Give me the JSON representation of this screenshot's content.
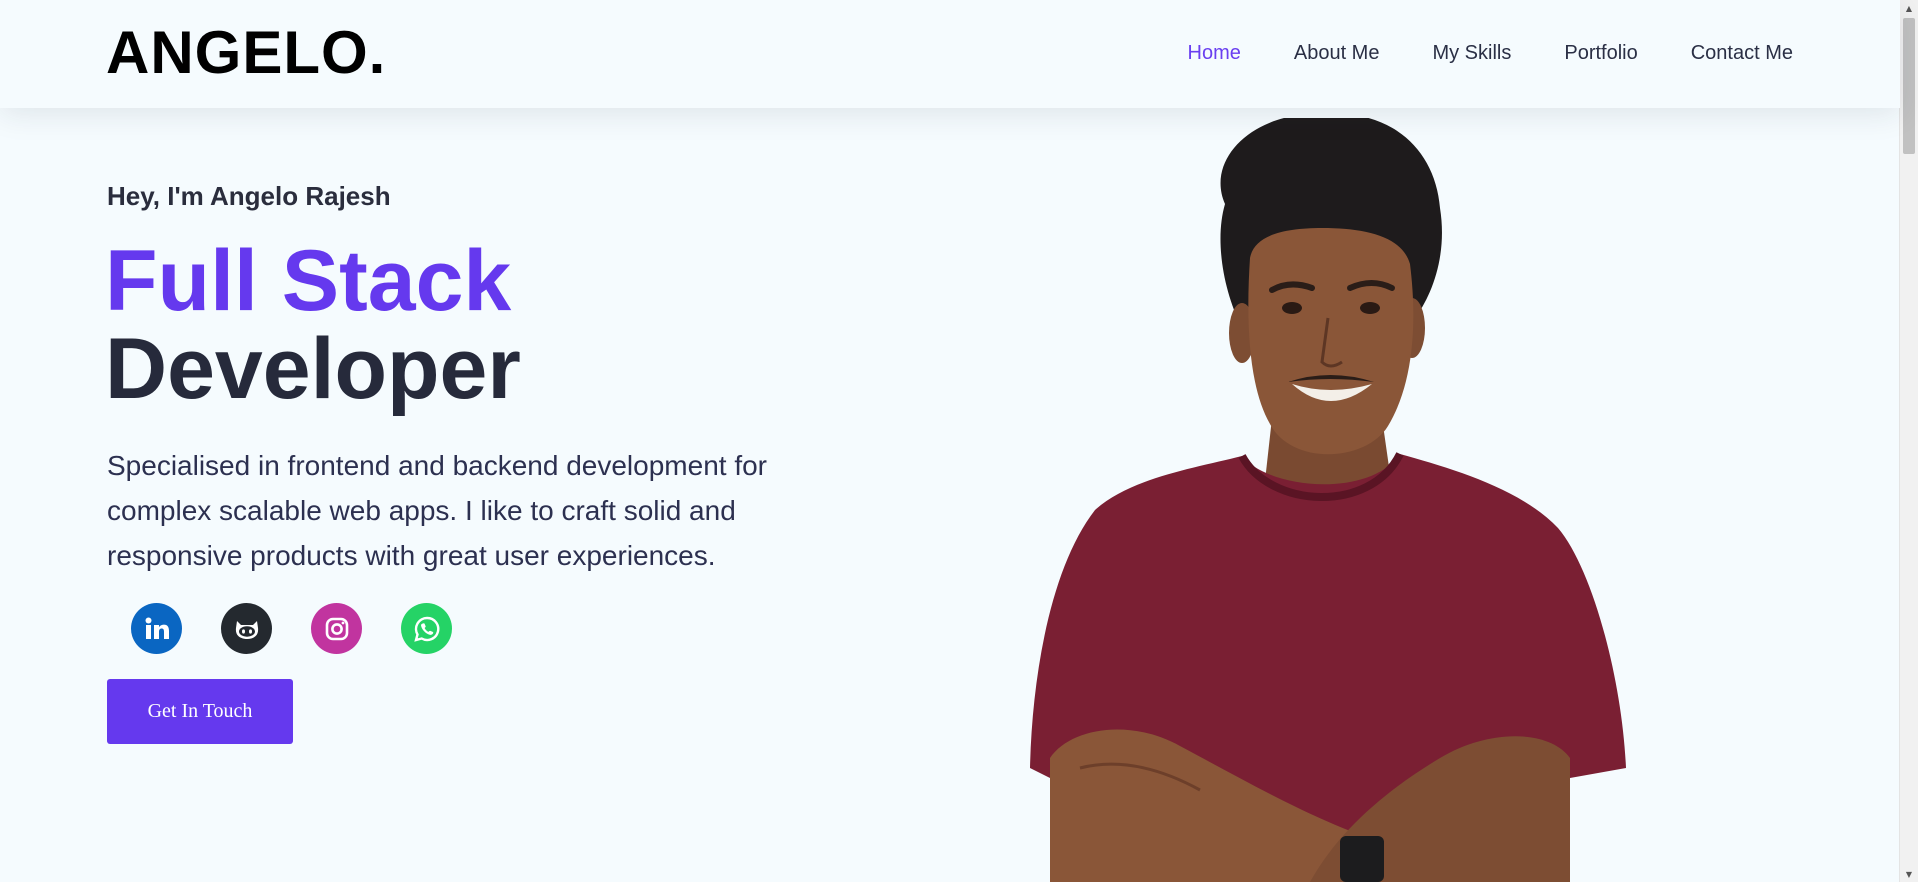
{
  "header": {
    "logo": "ANGELO.",
    "nav": [
      {
        "label": "Home",
        "active": true
      },
      {
        "label": "About Me",
        "active": false
      },
      {
        "label": "My Skills",
        "active": false
      },
      {
        "label": "Portfolio",
        "active": false
      },
      {
        "label": "Contact Me",
        "active": false
      }
    ]
  },
  "hero": {
    "greeting": "Hey, I'm Angelo Rajesh",
    "title_accent": "Full Stack",
    "title_main": "Developer",
    "description": "Specialised in frontend and backend development for complex scalable web apps. I like to craft solid and responsive products with great user experiences.",
    "socials": [
      {
        "icon": "linkedin-icon",
        "color": "#0a66c2"
      },
      {
        "icon": "github-icon",
        "color": "#24292f"
      },
      {
        "icon": "instagram-icon",
        "color": "#c1349f"
      },
      {
        "icon": "whatsapp-icon",
        "color": "#25d366"
      }
    ],
    "cta_label": "Get In Touch"
  },
  "colors": {
    "accent": "#6539ee",
    "nav_active": "#6a3ff0",
    "background": "#f5fbfe",
    "text_dark": "#262a3b"
  }
}
